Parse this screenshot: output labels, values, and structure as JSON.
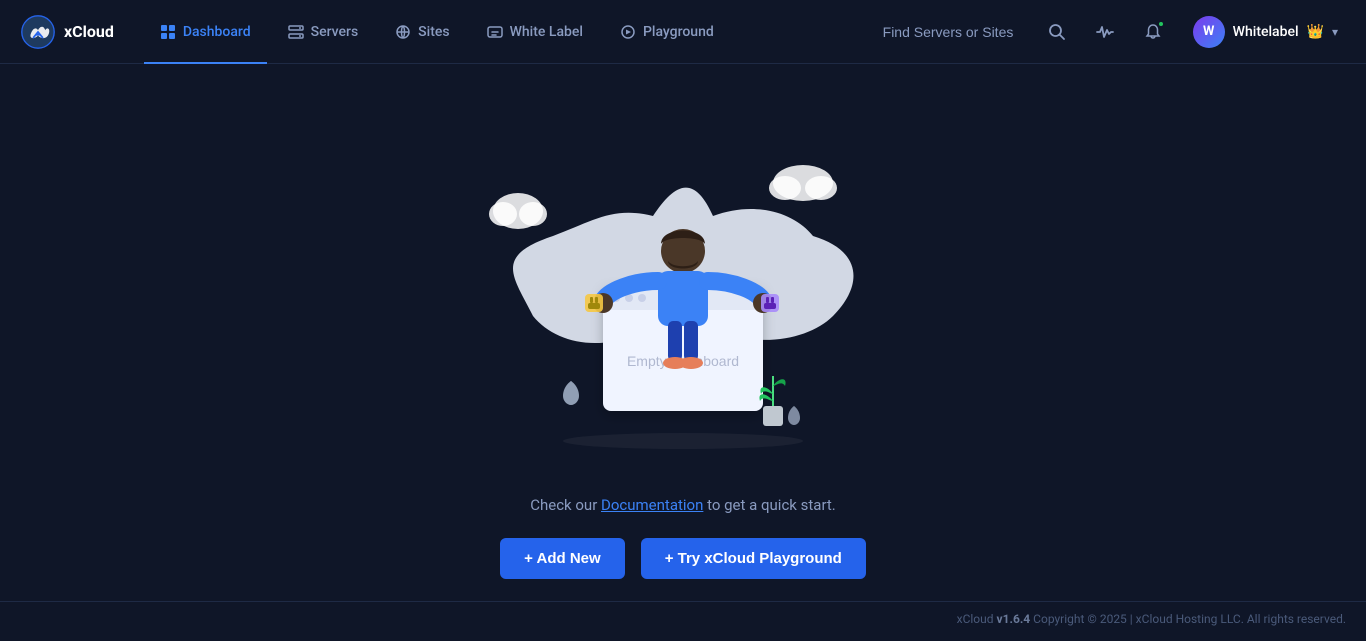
{
  "app": {
    "logo_text": "xCloud",
    "version": "v1.6.4"
  },
  "nav": {
    "links": [
      {
        "id": "dashboard",
        "label": "Dashboard",
        "active": true
      },
      {
        "id": "servers",
        "label": "Servers",
        "active": false
      },
      {
        "id": "sites",
        "label": "Sites",
        "active": false
      },
      {
        "id": "white-label",
        "label": "White Label",
        "active": false
      },
      {
        "id": "playground",
        "label": "Playground",
        "active": false
      }
    ]
  },
  "search": {
    "placeholder": "Find Servers or Sites"
  },
  "user": {
    "name": "Whitelabel",
    "initials": "W"
  },
  "main": {
    "empty_title": "Empty Dashboard",
    "cta_text_before": "Check our ",
    "cta_link_label": "Documentation",
    "cta_text_after": " to get a quick start.",
    "btn_add_new": "+ Add New",
    "btn_playground": "+ Try xCloud Playground"
  },
  "footer": {
    "text": "xCloud ",
    "version": "v1.6.4",
    "copyright": " Copyright © 2025 | xCloud Hosting LLC. All rights reserved."
  }
}
